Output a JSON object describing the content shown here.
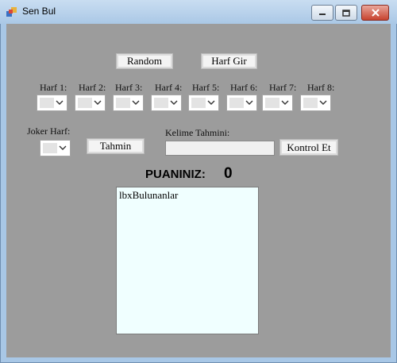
{
  "window": {
    "title": "Sen Bul"
  },
  "buttons": {
    "random": "Random",
    "harf_gir": "Harf Gir",
    "tahmin": "Tahmin",
    "kontrol_et": "Kontrol Et"
  },
  "letter_labels": [
    "Harf 1:",
    "Harf 2:",
    "Harf 3:",
    "Harf 4:",
    "Harf 5:",
    "Harf 6:",
    "Harf 7:",
    "Harf 8:"
  ],
  "joker_label": "Joker Harf:",
  "kelime_label": "Kelime Tahmini:",
  "kelime_value": "",
  "score": {
    "label": "PUANINIZ:",
    "value": "0"
  },
  "listbox": {
    "text": "lbxBulunanlar"
  }
}
